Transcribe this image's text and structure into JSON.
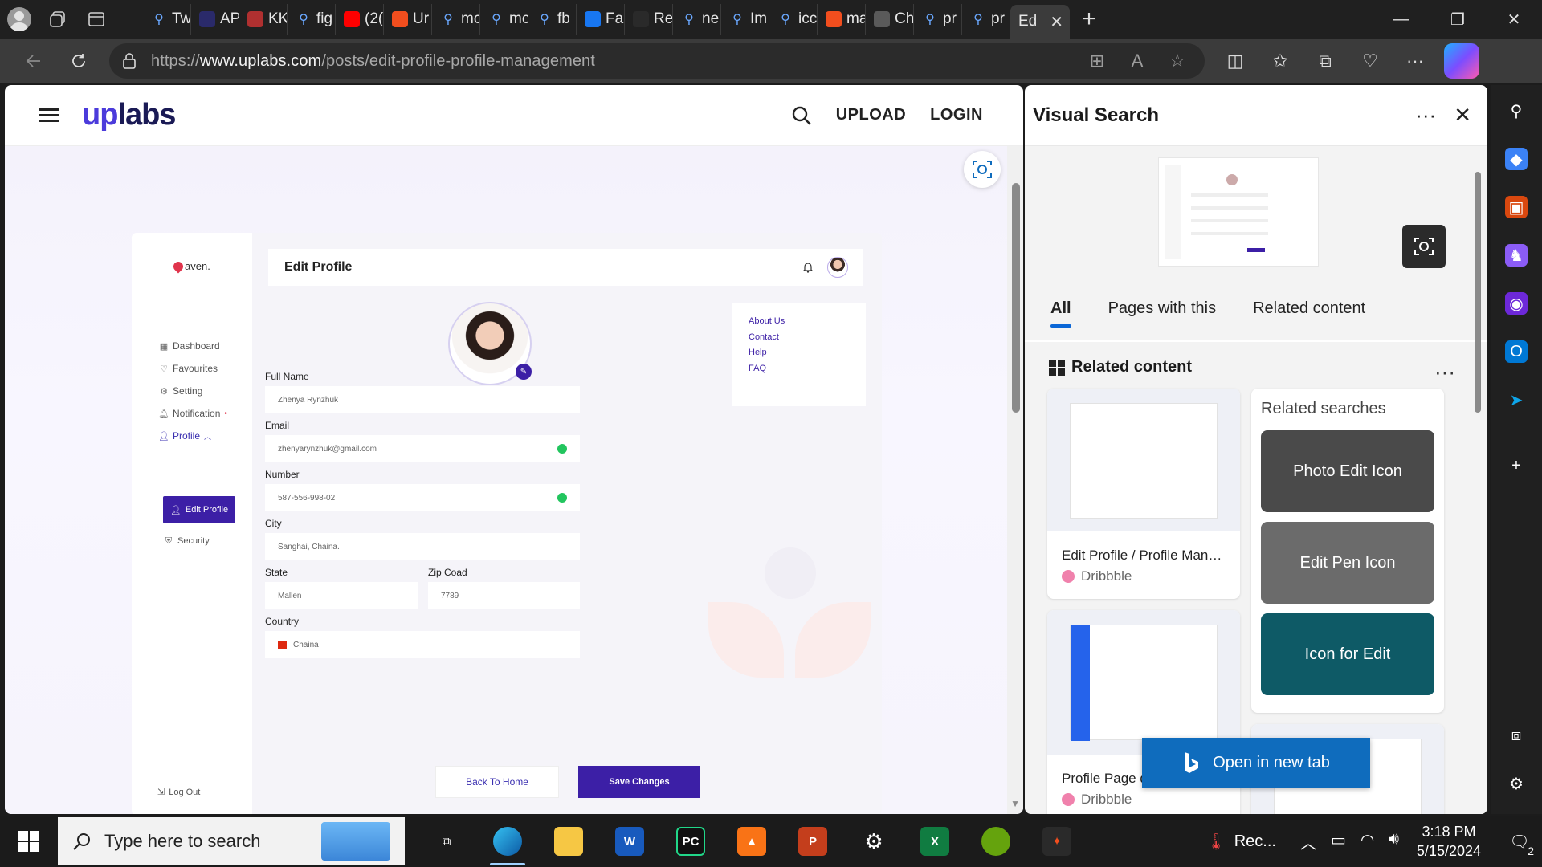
{
  "browser": {
    "tabs": [
      {
        "label": "Tw",
        "icon": "search-icon",
        "color": "#3a3a3a"
      },
      {
        "label": "AP",
        "icon": "triangle-icon",
        "color": "#2a2a6a"
      },
      {
        "label": "KK",
        "icon": "pdf-icon",
        "color": "#b03030"
      },
      {
        "label": "fig",
        "icon": "search-icon",
        "color": "#3a3a3a"
      },
      {
        "label": "(2(",
        "icon": "youtube-icon",
        "color": "#ff0000"
      },
      {
        "label": "Ur",
        "icon": "figma-icon",
        "color": "#f24e1e"
      },
      {
        "label": "mc",
        "icon": "search-icon",
        "color": "#3a3a3a"
      },
      {
        "label": "mc",
        "icon": "search-icon",
        "color": "#3a3a3a"
      },
      {
        "label": "fb",
        "icon": "search-icon",
        "color": "#3a3a3a"
      },
      {
        "label": "Fa",
        "icon": "facebook-icon",
        "color": "#1877f2"
      },
      {
        "label": "Re",
        "icon": "github-icon",
        "color": "#2a2a2a"
      },
      {
        "label": "ne",
        "icon": "search-icon",
        "color": "#3a3a3a"
      },
      {
        "label": "Im",
        "icon": "search-icon",
        "color": "#3a3a3a"
      },
      {
        "label": "icc",
        "icon": "search-icon",
        "color": "#3a3a3a"
      },
      {
        "label": "ma",
        "icon": "figma-icon",
        "color": "#f24e1e"
      },
      {
        "label": "Ch",
        "icon": "chatgpt-icon",
        "color": "#5a5a5a"
      },
      {
        "label": "pr",
        "icon": "search-icon",
        "color": "#3a3a3a"
      },
      {
        "label": "pr",
        "icon": "search-icon",
        "color": "#3a3a3a"
      }
    ],
    "active_tab_label": "Ed",
    "url_protocol": "https://",
    "url_domain": "www.uplabs.com",
    "url_path": "/posts/edit-profile-profile-management"
  },
  "site": {
    "logo_up": "up",
    "logo_rest": "labs",
    "upload": "UPLOAD",
    "login": "LOGIN"
  },
  "shot": {
    "brand": "aven.",
    "title": "Edit Profile",
    "nav": {
      "dashboard": "Dashboard",
      "favourites": "Favourites",
      "setting": "Setting",
      "notification": "Notification",
      "profile": "Profile",
      "edit_profile": "Edit Profile",
      "security": "Security",
      "logout": "Log Out"
    },
    "fields": {
      "full_name_label": "Full Name",
      "full_name": "Zhenya Rynzhuk",
      "email_label": "Email",
      "email": "zhenyarynzhuk@gmail.com",
      "number_label": "Number",
      "number": "587-556-998-02",
      "city_label": "City",
      "city": "Sanghai, Chaina.",
      "state_label": "State",
      "state": "Mallen",
      "zip_label": "Zip Coad",
      "zip": "7789",
      "country_label": "Country",
      "country": "Chaina"
    },
    "links": [
      "About  Us",
      "Contact",
      "Help",
      "FAQ"
    ],
    "back_button": "Back To Home",
    "save_button": "Save Changes"
  },
  "visual_search": {
    "title": "Visual Search",
    "tabs": [
      "All",
      "Pages with this",
      "Related content"
    ],
    "active_tab": "All",
    "section_title": "Related content",
    "cards": [
      {
        "title": "Edit Profile / Profile Mana...",
        "source": "Dribbble"
      },
      {
        "title": "Profile Page d",
        "source": "Dribbble"
      }
    ],
    "related_searches_title": "Related searches",
    "related_searches": [
      "Photo Edit Icon",
      "Edit Pen Icon",
      "Icon for Edit"
    ],
    "open_new_tab": "Open in new tab"
  },
  "taskbar": {
    "search_placeholder": "Type here to search",
    "weather_label": "Rec...",
    "time": "3:18 PM",
    "date": "5/15/2024",
    "notification_count": "2"
  },
  "colors": {
    "accent": "#3c1fa6",
    "edge_blue": "#0f6cbd",
    "valid_green": "#22c55e"
  }
}
